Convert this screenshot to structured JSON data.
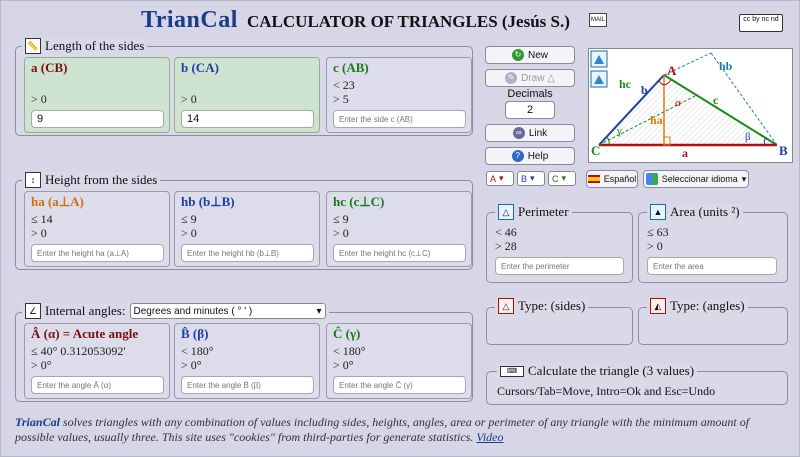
{
  "header": {
    "title": "TrianCal",
    "subtitle": "CALCULATOR OF TRIANGLES (Jesús S.)",
    "mail_label": "MAIL",
    "cc_label": "cc by nc nd"
  },
  "sides": {
    "legend": "Length of the sides",
    "a": {
      "label": "a (CB)",
      "conds": [
        "> 0"
      ],
      "value": "9",
      "placeholder": "Enter the side a (CB)"
    },
    "b": {
      "label": "b (CA)",
      "conds": [
        "> 0"
      ],
      "value": "14",
      "placeholder": "Enter the side b (CA)"
    },
    "c": {
      "label": "c (AB)",
      "conds": [
        "< 23",
        "> 5"
      ],
      "value": "",
      "placeholder": "Enter the side c (AB)"
    }
  },
  "heights": {
    "legend": "Height from the sides",
    "ha": {
      "label": "ha (a⊥A)",
      "conds": [
        "≤ 14",
        "> 0"
      ],
      "placeholder": "Enter the height ha (a⊥A)"
    },
    "hb": {
      "label": "hb (b⊥B)",
      "conds": [
        "≤ 9",
        "> 0"
      ],
      "placeholder": "Enter the height hb (b⊥B)"
    },
    "hc": {
      "label": "hc (c⊥C)",
      "conds": [
        "≤ 9",
        "> 0"
      ],
      "placeholder": "Enter the height hc (c⊥C)"
    }
  },
  "angles": {
    "legend": "Internal angles:",
    "unit_select": "Degrees and minutes ( ° ' )",
    "A": {
      "label": "Â (α) = Acute angle",
      "conds": [
        "≤ 40° 0.312053092'",
        "> 0°"
      ],
      "placeholder": "Enter the angle Â (α)"
    },
    "B": {
      "label": "B̂ (β)",
      "conds": [
        "< 180°",
        "> 0°"
      ],
      "placeholder": "Enter the angle B̂ (β)"
    },
    "C": {
      "label": "Ĉ (γ)",
      "conds": [
        "< 180°",
        "> 0°"
      ],
      "placeholder": "Enter the angle Ĉ (γ)"
    }
  },
  "controls": {
    "new_label": "New",
    "draw_label": "Draw △",
    "decimals_label": "Decimals",
    "decimals_value": "2",
    "link_label": "Link",
    "help_label": "Help",
    "sel_a": "A",
    "sel_b": "B",
    "sel_c": "C"
  },
  "diagram": {
    "vertex_A": "A",
    "vertex_B": "B",
    "vertex_C": "C",
    "side_a": "a",
    "side_b": "b",
    "side_c": "c",
    "h_a": "ha",
    "h_b": "hb",
    "h_c": "hc",
    "alpha": "α",
    "beta": "β",
    "gamma": "γ"
  },
  "lang": {
    "spanish_label": "Español",
    "select_label": "Seleccionar idioma"
  },
  "perimeter": {
    "legend": "Perimeter",
    "conds": [
      "< 46",
      "> 28"
    ],
    "placeholder": "Enter the perimeter"
  },
  "area": {
    "legend": "Area (units ²)",
    "conds": [
      "≤ 63",
      "> 0"
    ],
    "placeholder": "Enter the area"
  },
  "type_sides": {
    "legend": "Type: (sides)"
  },
  "type_angles": {
    "legend": "Type: (angles)"
  },
  "calc": {
    "legend": "Calculate the triangle (3 values)",
    "hint": "Cursors/Tab=Move, Intro=Ok and Esc=Undo"
  },
  "footer": {
    "brand": "TrianCal",
    "text": " solves triangles with any combination of values including sides, heights, angles, area or perimeter of any triangle with the minimum amount of possible values, usually three. This site uses \"cookies\" from third-parties for generate statistics. ",
    "link": "Video"
  }
}
